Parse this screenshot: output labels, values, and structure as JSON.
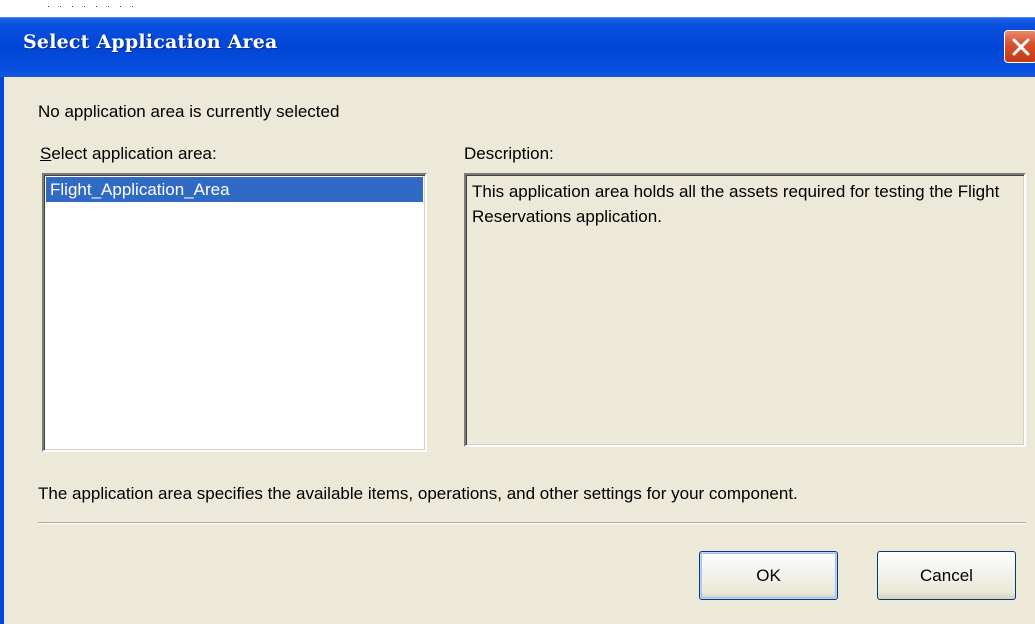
{
  "dialog": {
    "title": "Select Application Area",
    "status_text": "No application area is currently selected",
    "select_label_accel": "S",
    "select_label_rest": "elect application area:",
    "description_label": "Description:",
    "list_items": [
      "Flight_Application_Area"
    ],
    "selected_index": 0,
    "description_text": "This application area holds all the assets required for testing the Flight Reservations application.",
    "info_text": "The application area specifies the available items, operations, and other settings for your component.",
    "ok_label": "OK",
    "cancel_label": "Cancel"
  },
  "icons": {
    "close": "close-icon"
  },
  "colors": {
    "titlebar": "#0046d6",
    "selection": "#316ac5",
    "dialog_bg": "#ece9d8",
    "close_button": "#d9532e"
  }
}
